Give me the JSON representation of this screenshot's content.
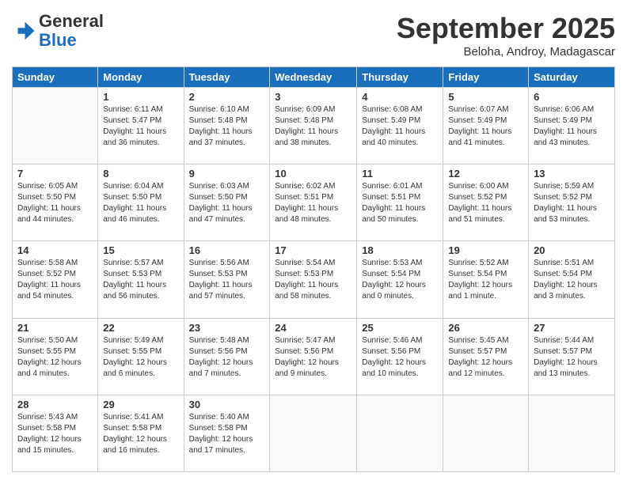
{
  "header": {
    "logo_line1": "General",
    "logo_line2": "Blue",
    "month": "September 2025",
    "location": "Beloha, Androy, Madagascar"
  },
  "days_of_week": [
    "Sunday",
    "Monday",
    "Tuesday",
    "Wednesday",
    "Thursday",
    "Friday",
    "Saturday"
  ],
  "weeks": [
    [
      {
        "day": "",
        "info": ""
      },
      {
        "day": "1",
        "info": "Sunrise: 6:11 AM\nSunset: 5:47 PM\nDaylight: 11 hours\nand 36 minutes."
      },
      {
        "day": "2",
        "info": "Sunrise: 6:10 AM\nSunset: 5:48 PM\nDaylight: 11 hours\nand 37 minutes."
      },
      {
        "day": "3",
        "info": "Sunrise: 6:09 AM\nSunset: 5:48 PM\nDaylight: 11 hours\nand 38 minutes."
      },
      {
        "day": "4",
        "info": "Sunrise: 6:08 AM\nSunset: 5:49 PM\nDaylight: 11 hours\nand 40 minutes."
      },
      {
        "day": "5",
        "info": "Sunrise: 6:07 AM\nSunset: 5:49 PM\nDaylight: 11 hours\nand 41 minutes."
      },
      {
        "day": "6",
        "info": "Sunrise: 6:06 AM\nSunset: 5:49 PM\nDaylight: 11 hours\nand 43 minutes."
      }
    ],
    [
      {
        "day": "7",
        "info": "Sunrise: 6:05 AM\nSunset: 5:50 PM\nDaylight: 11 hours\nand 44 minutes."
      },
      {
        "day": "8",
        "info": "Sunrise: 6:04 AM\nSunset: 5:50 PM\nDaylight: 11 hours\nand 46 minutes."
      },
      {
        "day": "9",
        "info": "Sunrise: 6:03 AM\nSunset: 5:50 PM\nDaylight: 11 hours\nand 47 minutes."
      },
      {
        "day": "10",
        "info": "Sunrise: 6:02 AM\nSunset: 5:51 PM\nDaylight: 11 hours\nand 48 minutes."
      },
      {
        "day": "11",
        "info": "Sunrise: 6:01 AM\nSunset: 5:51 PM\nDaylight: 11 hours\nand 50 minutes."
      },
      {
        "day": "12",
        "info": "Sunrise: 6:00 AM\nSunset: 5:52 PM\nDaylight: 11 hours\nand 51 minutes."
      },
      {
        "day": "13",
        "info": "Sunrise: 5:59 AM\nSunset: 5:52 PM\nDaylight: 11 hours\nand 53 minutes."
      }
    ],
    [
      {
        "day": "14",
        "info": "Sunrise: 5:58 AM\nSunset: 5:52 PM\nDaylight: 11 hours\nand 54 minutes."
      },
      {
        "day": "15",
        "info": "Sunrise: 5:57 AM\nSunset: 5:53 PM\nDaylight: 11 hours\nand 56 minutes."
      },
      {
        "day": "16",
        "info": "Sunrise: 5:56 AM\nSunset: 5:53 PM\nDaylight: 11 hours\nand 57 minutes."
      },
      {
        "day": "17",
        "info": "Sunrise: 5:54 AM\nSunset: 5:53 PM\nDaylight: 11 hours\nand 58 minutes."
      },
      {
        "day": "18",
        "info": "Sunrise: 5:53 AM\nSunset: 5:54 PM\nDaylight: 12 hours\nand 0 minutes."
      },
      {
        "day": "19",
        "info": "Sunrise: 5:52 AM\nSunset: 5:54 PM\nDaylight: 12 hours\nand 1 minute."
      },
      {
        "day": "20",
        "info": "Sunrise: 5:51 AM\nSunset: 5:54 PM\nDaylight: 12 hours\nand 3 minutes."
      }
    ],
    [
      {
        "day": "21",
        "info": "Sunrise: 5:50 AM\nSunset: 5:55 PM\nDaylight: 12 hours\nand 4 minutes."
      },
      {
        "day": "22",
        "info": "Sunrise: 5:49 AM\nSunset: 5:55 PM\nDaylight: 12 hours\nand 6 minutes."
      },
      {
        "day": "23",
        "info": "Sunrise: 5:48 AM\nSunset: 5:56 PM\nDaylight: 12 hours\nand 7 minutes."
      },
      {
        "day": "24",
        "info": "Sunrise: 5:47 AM\nSunset: 5:56 PM\nDaylight: 12 hours\nand 9 minutes."
      },
      {
        "day": "25",
        "info": "Sunrise: 5:46 AM\nSunset: 5:56 PM\nDaylight: 12 hours\nand 10 minutes."
      },
      {
        "day": "26",
        "info": "Sunrise: 5:45 AM\nSunset: 5:57 PM\nDaylight: 12 hours\nand 12 minutes."
      },
      {
        "day": "27",
        "info": "Sunrise: 5:44 AM\nSunset: 5:57 PM\nDaylight: 12 hours\nand 13 minutes."
      }
    ],
    [
      {
        "day": "28",
        "info": "Sunrise: 5:43 AM\nSunset: 5:58 PM\nDaylight: 12 hours\nand 15 minutes."
      },
      {
        "day": "29",
        "info": "Sunrise: 5:41 AM\nSunset: 5:58 PM\nDaylight: 12 hours\nand 16 minutes."
      },
      {
        "day": "30",
        "info": "Sunrise: 5:40 AM\nSunset: 5:58 PM\nDaylight: 12 hours\nand 17 minutes."
      },
      {
        "day": "",
        "info": ""
      },
      {
        "day": "",
        "info": ""
      },
      {
        "day": "",
        "info": ""
      },
      {
        "day": "",
        "info": ""
      }
    ]
  ]
}
